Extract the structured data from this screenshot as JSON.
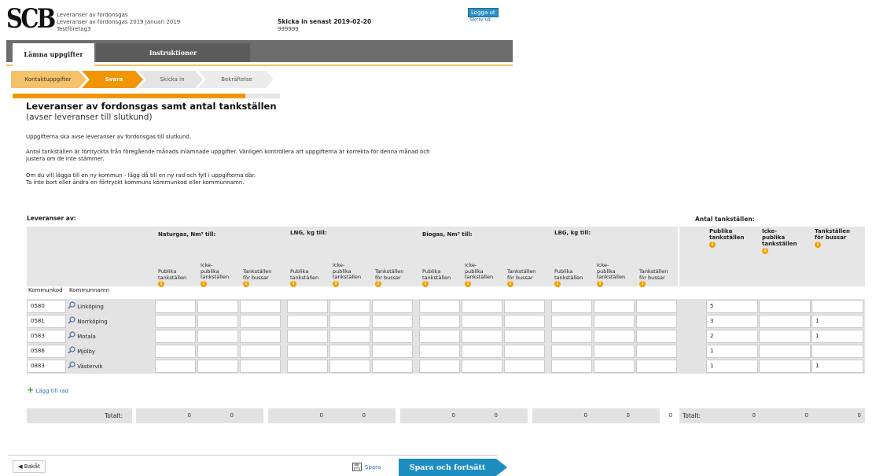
{
  "header": {
    "logo": "SCB",
    "lines": [
      "Leveranser av fordonsgas",
      "Leveranser av fordonsgas 2019 Januari 2019",
      "Testföretag3"
    ],
    "deadline_label": "Skicka in senast 2019-02-20",
    "id": "999999",
    "logout": "Logga ut",
    "print": "Skriv ut"
  },
  "tabs": [
    {
      "label": "Lämna uppgifter"
    },
    {
      "label": "Instruktioner"
    }
  ],
  "steps": [
    {
      "label": "Kontaktuppgifter"
    },
    {
      "label": "Svara"
    },
    {
      "label": "Skicka in"
    },
    {
      "label": "Bekräftelse"
    }
  ],
  "progress": 0.87,
  "colors": {
    "accent": "#f19500",
    "accent_light": "#f5c16a",
    "button_blue": "#1e8dc0",
    "tab_grey": "#6d6d6d"
  },
  "main": {
    "title": "Leveranser av fordonsgas samt antal tankställen",
    "subtitle": "(avser leveranser till slutkund)",
    "p1": "Uppgifterna ska avse leveranser av fordonsgas till slutkund.",
    "p2a": "Antal tankställen är förtryckta från föregående månads inlämnade uppgifter. Vänligen kontrollera att uppgifterna är korrekta för denna månad och",
    "p2b": "justera om de inte stämmer.",
    "p3a": "Om du vill lägga till en ny kommun - lägg då till en ny rad och fyll i uppgifterna där.",
    "p3b": "Ta inte bort eller ändra en förtryckt kommuns kommunkod eller kommunnamn."
  },
  "table": {
    "leveranser_label": "Leveranser av:",
    "antal_label": "Antal tankställen:",
    "groups": [
      "Naturgas, Nm³ till:",
      "LNG, kg till:",
      "Biogas, Nm³ till:",
      "LBG, kg till:"
    ],
    "sub": {
      "pub1": "Publika",
      "pub2": "tankställen",
      "icke1": "Icke-",
      "icke2": "publika",
      "icke3": "tankställen",
      "bus1": "Tankställen",
      "bus2": "för bussar"
    },
    "right_heads": {
      "pub1": "Publika",
      "pub2": "tankställen",
      "icke1": "Icke-",
      "icke2": "publika",
      "icke3": "tankställen",
      "bus1": "Tankställen",
      "bus2": "för bussar"
    },
    "col_kommunkod": "Kommunkod",
    "col_kommunnamn": "Kommunnamn",
    "rows": [
      {
        "kod": "0580",
        "namn": "Linköping",
        "pub": "5",
        "icke": "",
        "bus": ""
      },
      {
        "kod": "0581",
        "namn": "Norrköping",
        "pub": "3",
        "icke": "",
        "bus": "1"
      },
      {
        "kod": "0583",
        "namn": "Motala",
        "pub": "2",
        "icke": "",
        "bus": "1"
      },
      {
        "kod": "0586",
        "namn": "Mjölby",
        "pub": "1",
        "icke": "",
        "bus": ""
      },
      {
        "kod": "0883",
        "namn": "Västervik",
        "pub": "1",
        "icke": "",
        "bus": "1"
      }
    ],
    "add_row": "Lägg till rad",
    "total_label": "Totalt:",
    "totals": [
      "0",
      "0",
      "0",
      "0",
      "0",
      "0",
      "0",
      "0",
      "0",
      "0",
      "0",
      "0"
    ],
    "right_totals": [
      "0",
      "0",
      "0"
    ]
  },
  "footer": {
    "back": "◀ Bakåt",
    "save": "Spara",
    "save_continue": "Spara och fortsätt"
  }
}
